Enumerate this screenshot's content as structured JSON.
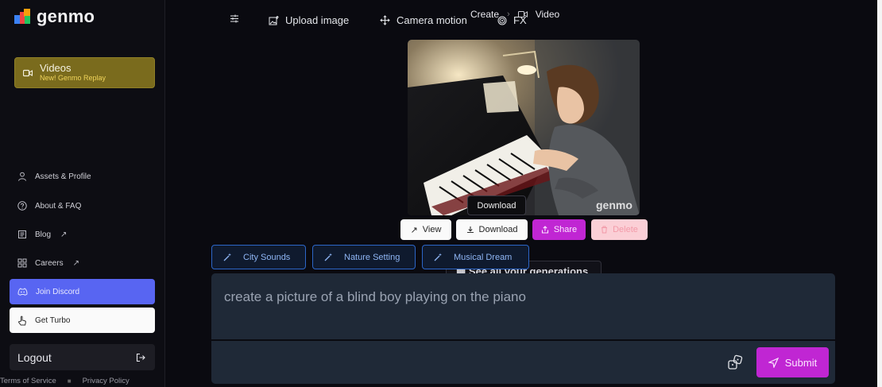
{
  "app": {
    "logo_text": "genmo"
  },
  "sidebar": {
    "videos": {
      "title": "Videos",
      "subtitle": "New! Genmo Replay"
    },
    "items": [
      {
        "label": "Assets & Profile",
        "icon": "user-icon"
      },
      {
        "label": "About & FAQ",
        "icon": "help-circle-icon"
      },
      {
        "label": "Blog",
        "icon": "newspaper-icon",
        "external": true
      },
      {
        "label": "Careers",
        "icon": "careers-icon",
        "external": true
      }
    ],
    "discord_label": "Join Discord",
    "turbo_label": "Get Turbo",
    "logout_label": "Logout",
    "footer": {
      "terms": "Terms of Service",
      "privacy": "Privacy Policy"
    }
  },
  "breadcrumb": {
    "parent": "Create",
    "current": "Video"
  },
  "video": {
    "watermark": "genmo"
  },
  "tooltip": "Download",
  "actions": {
    "view": "View",
    "download": "Download",
    "share": "Share",
    "delete": "Delete"
  },
  "suggestions": [
    "City Sounds",
    "Nature Setting",
    "Musical Dream"
  ],
  "see_all": "See all your generations",
  "prompt": {
    "text": "create a picture of a blind boy playing on the piano"
  },
  "toolbar": {
    "upload": "Upload image",
    "camera": "Camera motion",
    "fx": "FX",
    "submit": "Submit"
  },
  "colors": {
    "accent": "#c026d3",
    "discord": "#5865f2",
    "videos_card": "#7a6b1d",
    "chip_border": "#2c66c8"
  }
}
